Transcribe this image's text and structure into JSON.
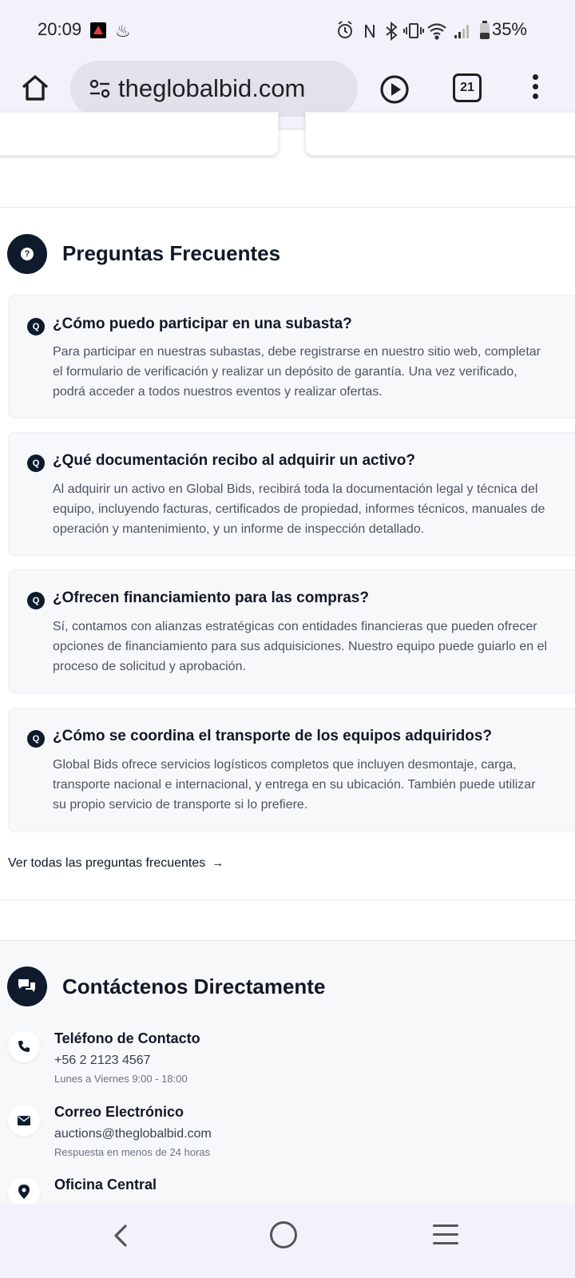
{
  "status": {
    "time": "20:09",
    "battery": "35%",
    "icons": [
      "alarm-icon",
      "nfc-icon",
      "bluetooth-icon",
      "vibrate-icon",
      "wifi-icon",
      "signal-icon",
      "battery-icon"
    ]
  },
  "browser": {
    "url": "theglobalbid.com",
    "tab_count": "21"
  },
  "faq": {
    "title": "Preguntas Frecuentes",
    "badge": "Q",
    "items": [
      {
        "question": "¿Cómo puedo participar en una subasta?",
        "answer": "Para participar en nuestras subastas, debe registrarse en nuestro sitio web, completar el formulario de verificación y realizar un depósito de garantía. Una vez verificado, podrá acceder a todos nuestros eventos y realizar ofertas."
      },
      {
        "question": "¿Qué documentación recibo al adquirir un activo?",
        "answer": "Al adquirir un activo en Global Bids, recibirá toda la documentación legal y técnica del equipo, incluyendo facturas, certificados de propiedad, informes técnicos, manuales de operación y mantenimiento, y un informe de inspección detallado."
      },
      {
        "question": "¿Ofrecen financiamiento para las compras?",
        "answer": "Sí, contamos con alianzas estratégicas con entidades financieras que pueden ofrecer opciones de financiamiento para sus adquisiciones. Nuestro equipo puede guiarlo en el proceso de solicitud y aprobación."
      },
      {
        "question": "¿Cómo se coordina el transporte de los equipos adquiridos?",
        "answer": "Global Bids ofrece servicios logísticos completos que incluyen desmontaje, carga, transporte nacional e internacional, y entrega en su ubicación. También puede utilizar su propio servicio de transporte si lo prefiere."
      }
    ],
    "view_all": "Ver todas las preguntas frecuentes",
    "view_all_arrow": "→"
  },
  "contact": {
    "title": "Contáctenos Directamente",
    "phone": {
      "title": "Teléfono de Contacto",
      "value": "+56 2 2123 4567",
      "sub": "Lunes a Viernes 9:00 - 18:00"
    },
    "email": {
      "title": "Correo Electrónico",
      "value": "auctions@theglobalbid.com",
      "sub": "Respuesta en menos de 24 horas"
    },
    "office": {
      "title": "Oficina Central"
    }
  }
}
